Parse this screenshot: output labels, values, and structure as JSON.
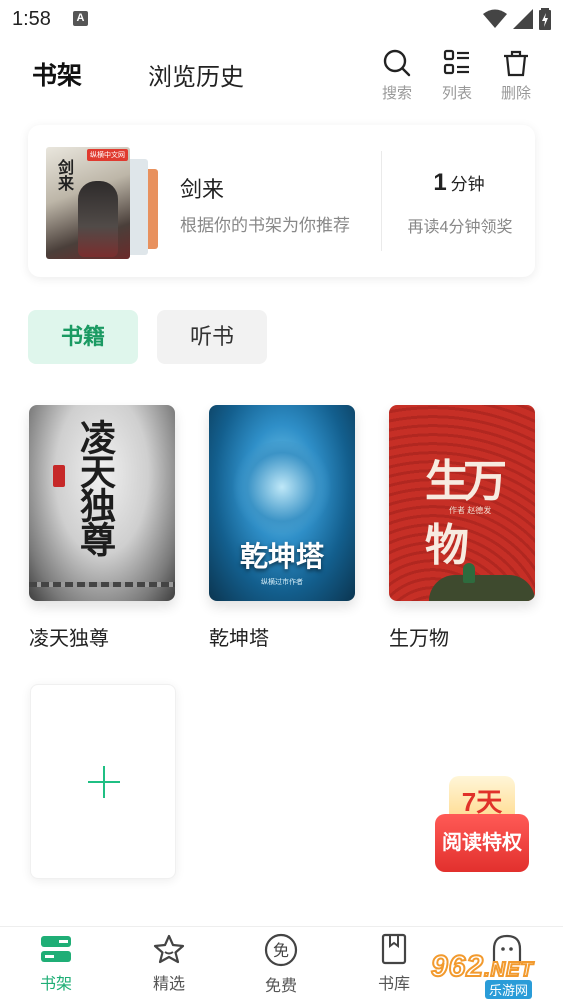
{
  "status_bar": {
    "time": "1:58",
    "notif_icon_letter": "A"
  },
  "header": {
    "tab_shelf": "书架",
    "tab_history": "浏览历史",
    "search_label": "搜索",
    "list_label": "列表",
    "delete_label": "删除"
  },
  "recommend": {
    "title": "剑来",
    "subtitle": "根据你的书架为你推荐",
    "minutes": "1",
    "minutes_unit": "分钟",
    "reward_text": "再读4分钟领奖",
    "cover_title": "剑来",
    "cover_badge": "纵横中文网"
  },
  "categories": {
    "books": "书籍",
    "audio": "听书"
  },
  "books": [
    {
      "name": "凌天独尊",
      "cover_title": "凌天独尊"
    },
    {
      "name": "乾坤塔",
      "cover_title": "乾坤塔",
      "cover_sub": "纵横过市作者"
    },
    {
      "name": "生万物",
      "cover_title": "生万物",
      "cover_author": "作者 赵德发"
    }
  ],
  "promo": {
    "top": "7天",
    "bottom": "阅读特权"
  },
  "bottom_nav": {
    "shelf": "书架",
    "featured": "精选",
    "free": "免费",
    "library": "书库"
  },
  "watermark": {
    "main": "962",
    "suffix": ".NET",
    "sub": "乐游网"
  },
  "colors": {
    "accent": "#1fae76",
    "chip_bg": "#dff6ec",
    "promo_red": "#e2302d"
  },
  "icons": [
    "search-icon",
    "list-icon",
    "trash-icon",
    "bookshelf-icon",
    "star-icon",
    "free-icon",
    "library-icon",
    "profile-icon",
    "plus-icon"
  ]
}
